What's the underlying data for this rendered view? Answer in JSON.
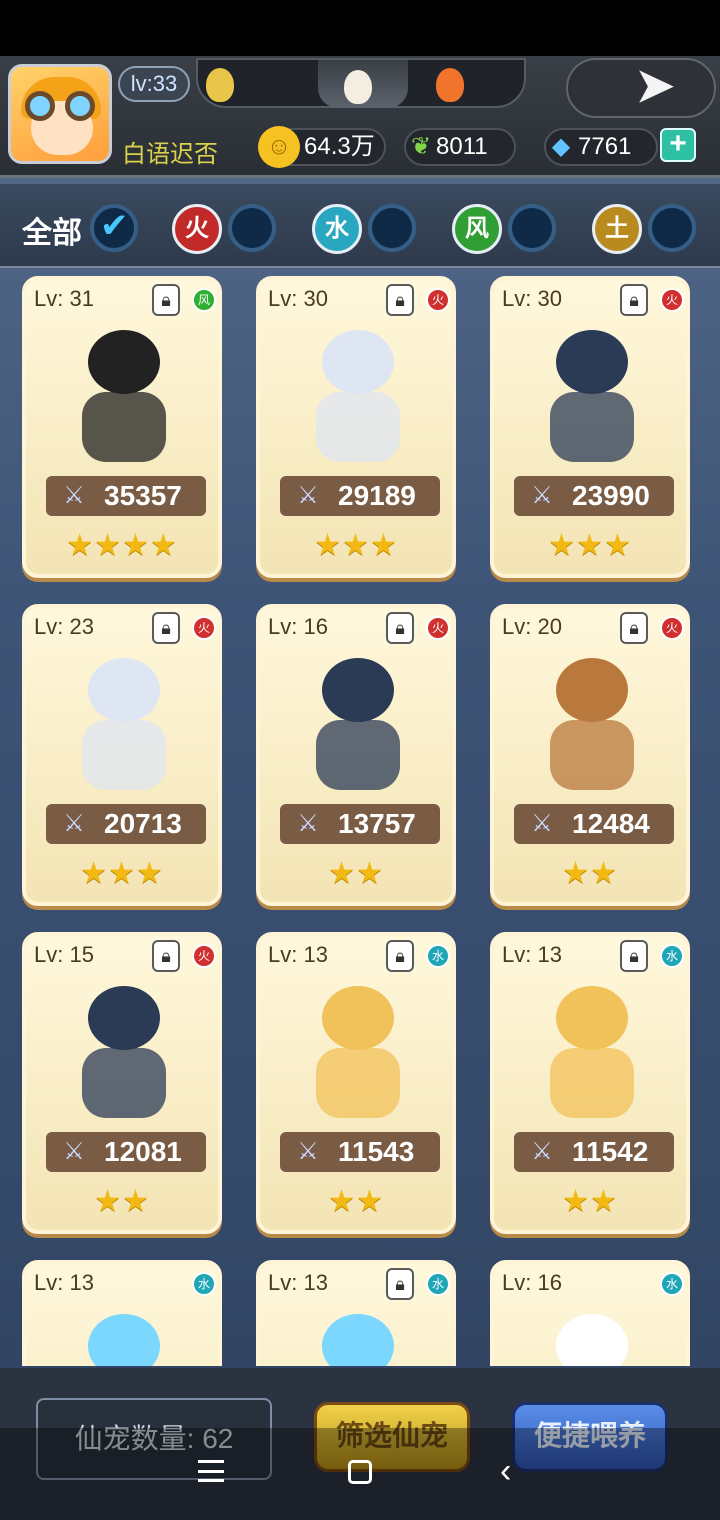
{
  "player": {
    "level": "lv:33",
    "name": "白语迟否"
  },
  "resources": {
    "gold": "64.3万",
    "leaf": "8011",
    "gem": "7761",
    "plus": "+"
  },
  "filters": {
    "all": "全部",
    "fire": "火",
    "water": "水",
    "wind": "风",
    "earth": "土"
  },
  "pets": [
    {
      "lv": "Lv: 31",
      "power": "35357",
      "stars": "★★★★",
      "element": "风",
      "elemColor": "#2fae2f",
      "locked": true,
      "art": "#222222"
    },
    {
      "lv": "Lv: 30",
      "power": "29189",
      "stars": "★★★",
      "element": "火",
      "elemColor": "#d0302f",
      "locked": true,
      "art": "#dfe6f3"
    },
    {
      "lv": "Lv: 30",
      "power": "23990",
      "stars": "★★★",
      "element": "火",
      "elemColor": "#d0302f",
      "locked": true,
      "art": "#2b3b55"
    },
    {
      "lv": "Lv: 23",
      "power": "20713",
      "stars": "★★★",
      "element": "火",
      "elemColor": "#d0302f",
      "locked": true,
      "art": "#dfe6f3"
    },
    {
      "lv": "Lv: 16",
      "power": "13757",
      "stars": "★★",
      "element": "火",
      "elemColor": "#d0302f",
      "locked": true,
      "art": "#2b3b55"
    },
    {
      "lv": "Lv: 20",
      "power": "12484",
      "stars": "★★",
      "element": "火",
      "elemColor": "#d0302f",
      "locked": true,
      "art": "#b9783c"
    },
    {
      "lv": "Lv: 15",
      "power": "12081",
      "stars": "★★",
      "element": "火",
      "elemColor": "#d0302f",
      "locked": true,
      "art": "#2b3b55"
    },
    {
      "lv": "Lv: 13",
      "power": "11543",
      "stars": "★★",
      "element": "水",
      "elemColor": "#1fa7b8",
      "locked": true,
      "art": "#f2c25a"
    },
    {
      "lv": "Lv: 13",
      "power": "11542",
      "stars": "★★",
      "element": "水",
      "elemColor": "#1fa7b8",
      "locked": true,
      "art": "#f2c25a"
    },
    {
      "lv": "Lv: 13",
      "power": "",
      "stars": "",
      "element": "水",
      "elemColor": "#1fa7b8",
      "locked": false,
      "art": "#7cd7ff"
    },
    {
      "lv": "Lv: 13",
      "power": "",
      "stars": "",
      "element": "水",
      "elemColor": "#1fa7b8",
      "locked": true,
      "art": "#7cd7ff"
    },
    {
      "lv": "Lv: 16",
      "power": "",
      "stars": "",
      "element": "水",
      "elemColor": "#1fa7b8",
      "locked": false,
      "art": "#ffffff"
    }
  ],
  "bottom": {
    "count": "仙宠数量: 62",
    "filter": "筛选仙宠",
    "feed": "便捷喂养"
  },
  "icons": {
    "coin": "coin-icon",
    "leaf": "leaf-icon",
    "gem": "gem-icon",
    "lock": "lock-icon",
    "sword": "sword-icon",
    "exit": "exit-icon"
  }
}
